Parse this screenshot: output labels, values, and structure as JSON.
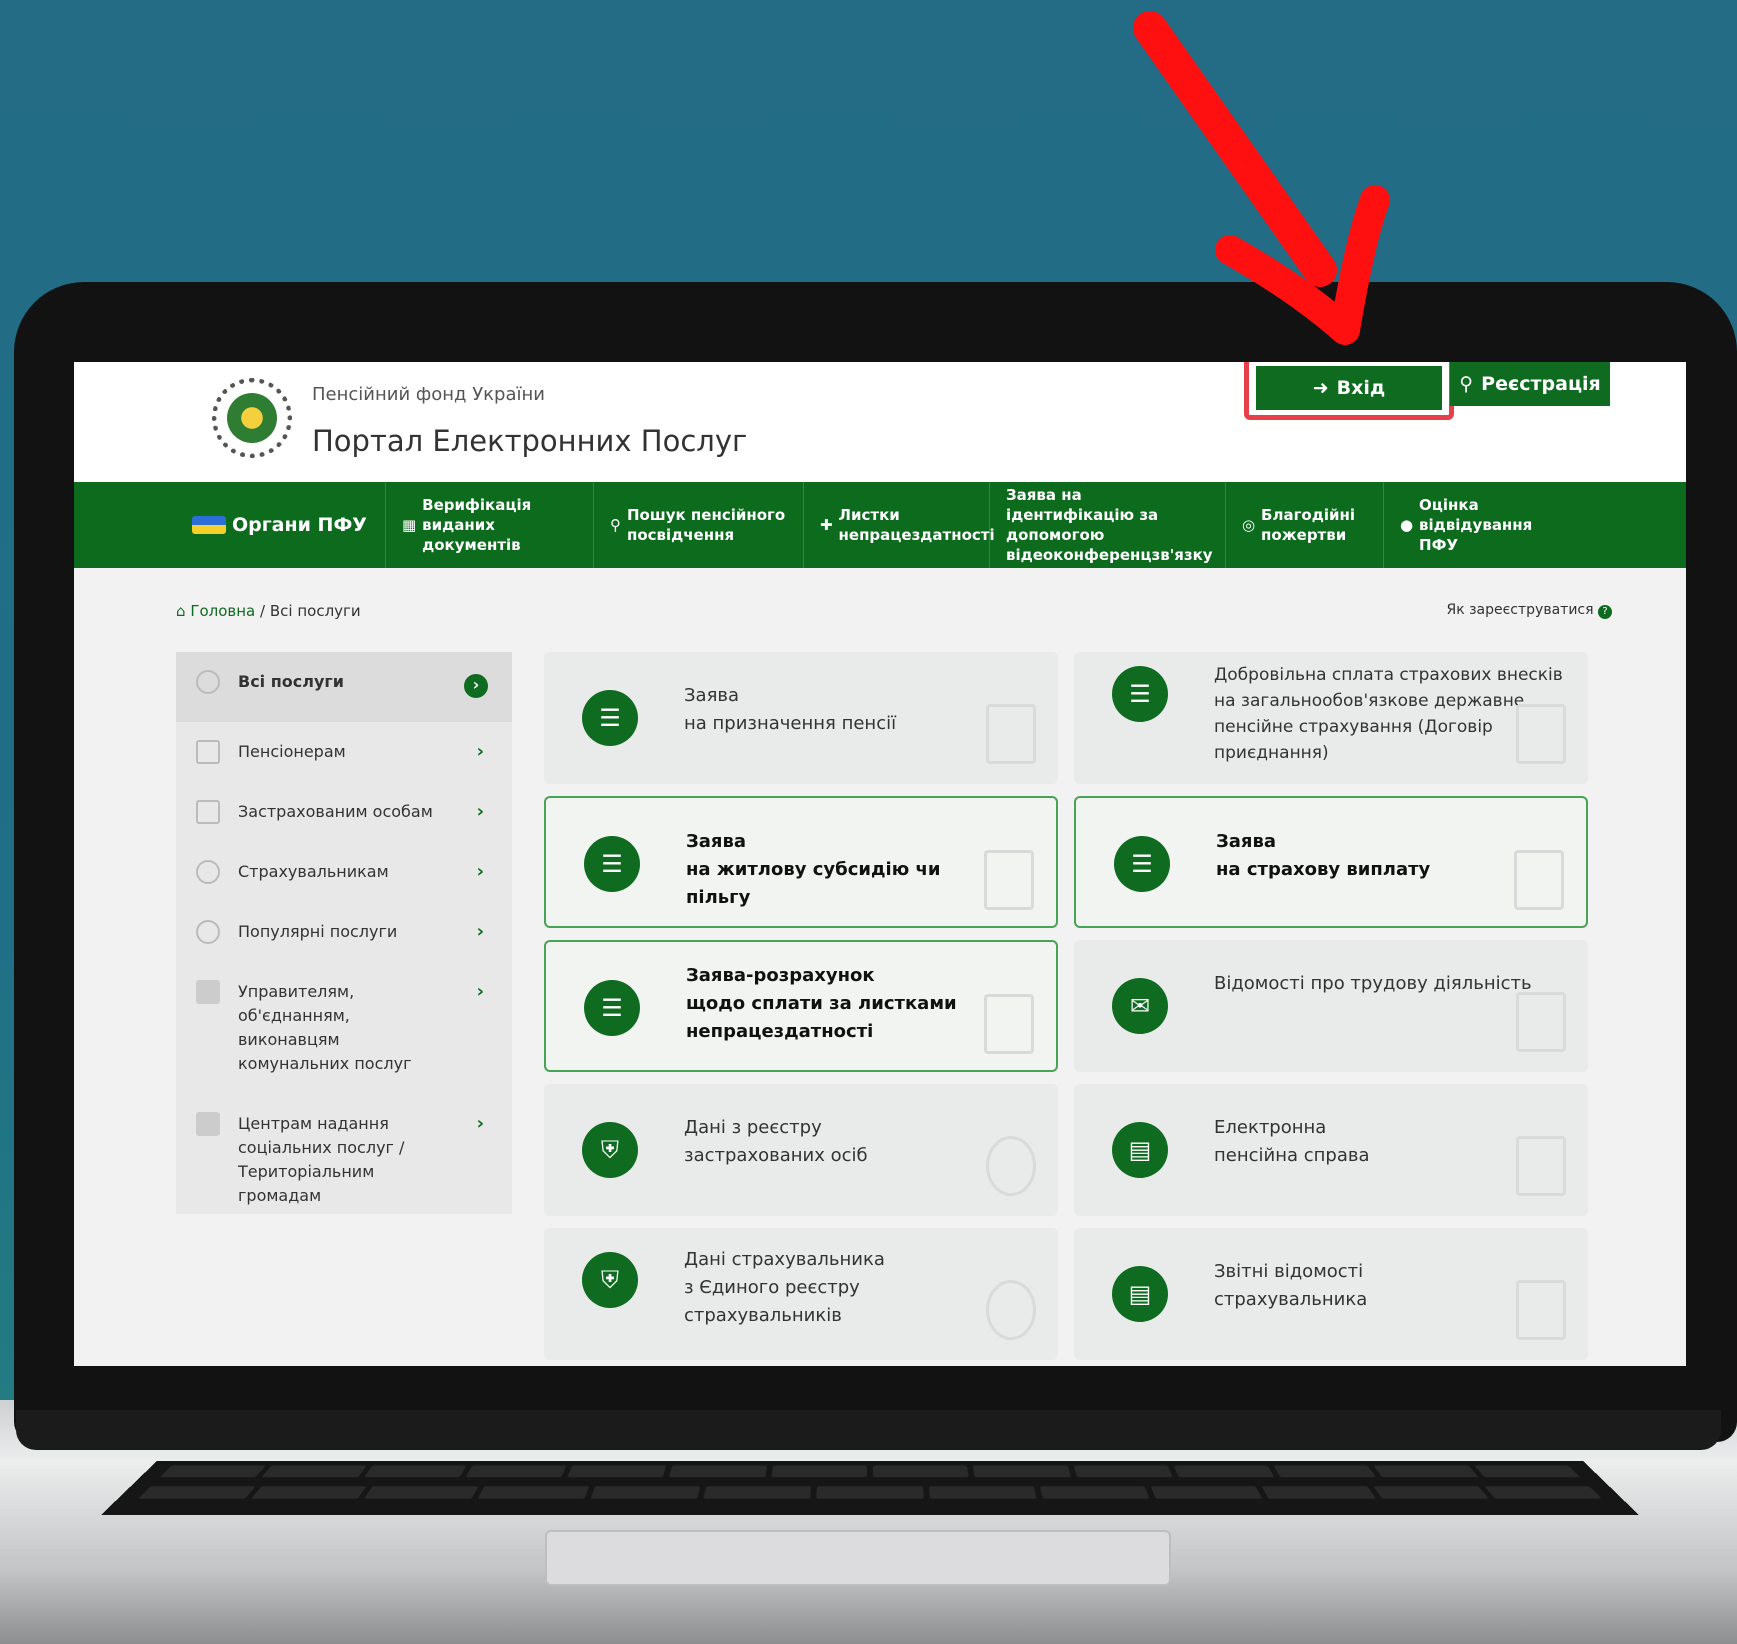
{
  "header": {
    "org_name": "Пенсійний фонд України",
    "portal_title": "Портал Електронних Послуг",
    "login_label": "Вхід",
    "register_label": "Реєстрація"
  },
  "nav": {
    "items": [
      {
        "label": "Органи ПФУ",
        "icon": "flag-icon"
      },
      {
        "label": "Верифікація виданих документів",
        "icon": "qr-icon"
      },
      {
        "label": "Пошук пенсійного посвідчення",
        "icon": "search-icon"
      },
      {
        "label": "Листки непрацездатності",
        "icon": "medkit-icon"
      },
      {
        "label": "Заява на ідентифікацію за допомогою відеоконференцзв'язку",
        "icon": ""
      },
      {
        "label": "Благодійні пожертви",
        "icon": "coins-icon"
      },
      {
        "label": "Оцінка відвідування ПФУ",
        "icon": "comment-icon"
      }
    ]
  },
  "breadcrumb": {
    "home": "Головна",
    "separator": "/",
    "current": "Всі послуги"
  },
  "howto_register": "Як зареєструватися",
  "sidebar": {
    "items": [
      {
        "label": "Всі послуги"
      },
      {
        "label": "Пенсіонерам"
      },
      {
        "label": "Застрахованим особам"
      },
      {
        "label": "Страхувальникам"
      },
      {
        "label": "Популярні послуги"
      },
      {
        "label": "Управителям, об'єднанням, виконавцям комунальних послуг"
      },
      {
        "label": "Центрам надання соціальних послуг / Територіальним громадам"
      }
    ]
  },
  "cards": [
    {
      "line1": "Заява",
      "line2": "на призначення пенсії",
      "line3": ""
    },
    {
      "line1": "Добровільна сплата страхових внесків",
      "line2": "на загальнообов'язкове державне",
      "line3": "пенсійне страхування (Договір приєднання)"
    },
    {
      "line1": "Заява",
      "line2": "на житлову субсидію чи пільгу",
      "line3": ""
    },
    {
      "line1": "Заява",
      "line2": "на страхову виплату",
      "line3": ""
    },
    {
      "line1": "Заява-розрахунок",
      "line2": "щодо сплати за листками",
      "line3": "непрацездатності"
    },
    {
      "line1": "Відомості про трудову діяльність",
      "line2": "",
      "line3": ""
    },
    {
      "line1": "Дані з реєстру",
      "line2": "застрахованих осіб",
      "line3": ""
    },
    {
      "line1": "Електронна",
      "line2": "пенсійна справа",
      "line3": ""
    },
    {
      "line1": "Дані страхувальника",
      "line2": "з Єдиного реєстру",
      "line3": "страхувальників"
    },
    {
      "line1": "Звітні відомості",
      "line2": "страхувальника",
      "line3": ""
    }
  ],
  "colors": {
    "primary_green": "#0e6b1f",
    "highlight_red": "#e8404a",
    "arrow_red": "#ff1010"
  }
}
